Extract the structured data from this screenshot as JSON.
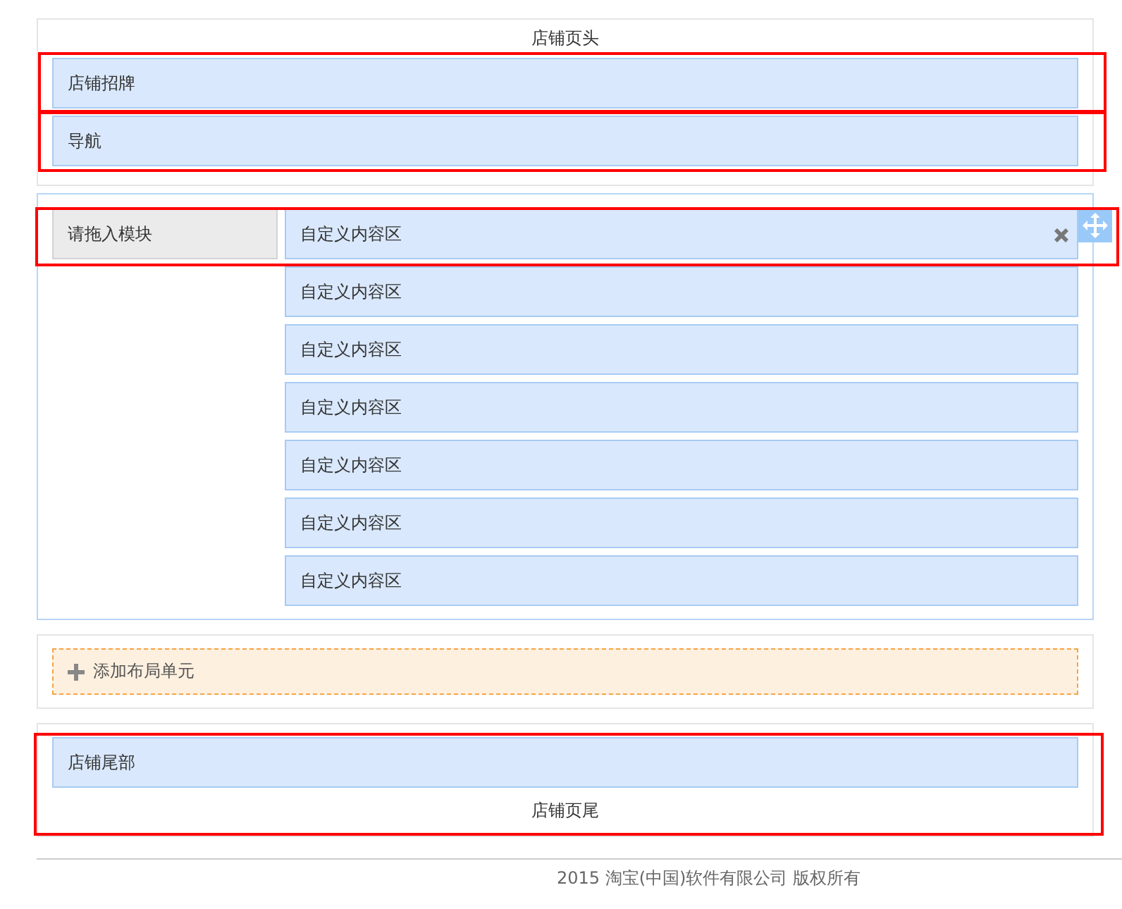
{
  "header": {
    "title": "店铺页头",
    "modules": [
      {
        "label": "店铺招牌",
        "highlighted": true
      },
      {
        "label": "导航",
        "highlighted": true
      }
    ]
  },
  "layout": {
    "rows": [
      {
        "left": "请拖入模块",
        "right": "自定义内容区",
        "highlighted": true,
        "active": true
      },
      {
        "right": "自定义内容区",
        "highlighted": false,
        "active": false
      },
      {
        "right": "自定义内容区",
        "highlighted": false,
        "active": false
      },
      {
        "right": "自定义内容区",
        "highlighted": false,
        "active": false
      },
      {
        "right": "自定义内容区",
        "highlighted": false,
        "active": false
      },
      {
        "right": "自定义内容区",
        "highlighted": false,
        "active": false
      },
      {
        "right": "自定义内容区",
        "highlighted": false,
        "active": false
      }
    ]
  },
  "add_layout": {
    "label": "添加布局单元"
  },
  "footer": {
    "highlighted": true,
    "modules": [
      {
        "label": "店铺尾部"
      }
    ],
    "title": "店铺页尾"
  },
  "copyright": "2015 淘宝(中国)软件有限公司 版权所有"
}
